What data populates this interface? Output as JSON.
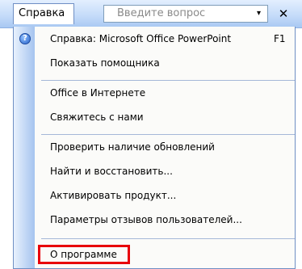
{
  "menubar": {
    "menu_title": "Справка",
    "search_placeholder": "Введите вопрос",
    "dropdown_arrow": "▾",
    "close_glyph": "✕"
  },
  "menu": {
    "items": [
      {
        "label": "Справка: Microsoft Office PowerPoint",
        "shortcut": "F1",
        "icon": "help-icon"
      },
      {
        "label": "Показать помощника"
      },
      {
        "label": "Office в Интернете"
      },
      {
        "label": "Свяжитесь с нами"
      },
      {
        "label": "Проверить наличие обновлений"
      },
      {
        "label": "Найти и восстановить..."
      },
      {
        "label": "Активировать продукт..."
      },
      {
        "label": "Параметры отзывов пользователей..."
      },
      {
        "label": "О программе"
      }
    ],
    "help_glyph": "?"
  },
  "colors": {
    "highlight": "#e8000b",
    "menubar_accent": "#c3daf9"
  }
}
